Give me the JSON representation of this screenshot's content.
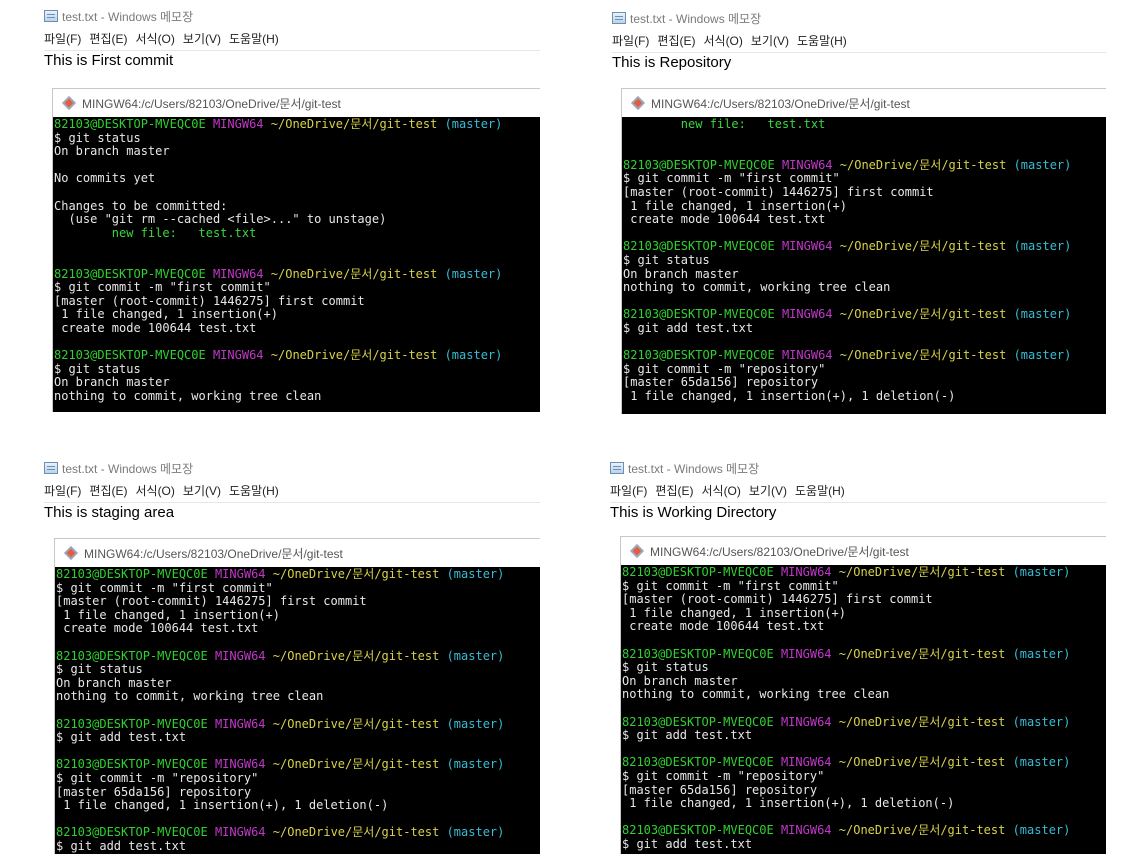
{
  "notepad": {
    "title": "test.txt - Windows 메모장",
    "menu": [
      "파일(F)",
      "편집(E)",
      "서식(O)",
      "보기(V)",
      "도움말(H)"
    ]
  },
  "terminal_title": "MINGW64:/c/Users/82103/OneDrive/문서/git-test",
  "prompt": {
    "user": "82103@DESKTOP-MVEQC0E",
    "env": "MINGW64",
    "path": "~/OneDrive/문서/git-test",
    "branch": "(master)"
  },
  "panels": [
    {
      "file_text": "This is First commit",
      "lines": [
        {
          "t": "prompt"
        },
        {
          "t": "text",
          "v": "$ git status"
        },
        {
          "t": "text",
          "v": "On branch master"
        },
        {
          "t": "blank"
        },
        {
          "t": "text",
          "v": "No commits yet"
        },
        {
          "t": "blank"
        },
        {
          "t": "text",
          "v": "Changes to be committed:"
        },
        {
          "t": "text",
          "v": "  (use \"git rm --cached <file>...\" to unstage)"
        },
        {
          "t": "green",
          "v": "        new file:   test.txt"
        },
        {
          "t": "blank"
        },
        {
          "t": "blank"
        },
        {
          "t": "prompt"
        },
        {
          "t": "text",
          "v": "$ git commit -m \"first commit\""
        },
        {
          "t": "text",
          "v": "[master (root-commit) 1446275] first commit"
        },
        {
          "t": "text",
          "v": " 1 file changed, 1 insertion(+)"
        },
        {
          "t": "text",
          "v": " create mode 100644 test.txt"
        },
        {
          "t": "blank"
        },
        {
          "t": "prompt"
        },
        {
          "t": "text",
          "v": "$ git status"
        },
        {
          "t": "text",
          "v": "On branch master"
        },
        {
          "t": "text",
          "v": "nothing to commit, working tree clean"
        }
      ]
    },
    {
      "file_text": "This is Repository",
      "lines": [
        {
          "t": "green",
          "v": "        new file:   test.txt"
        },
        {
          "t": "blank"
        },
        {
          "t": "blank"
        },
        {
          "t": "prompt"
        },
        {
          "t": "text",
          "v": "$ git commit -m \"first commit\""
        },
        {
          "t": "text",
          "v": "[master (root-commit) 1446275] first commit"
        },
        {
          "t": "text",
          "v": " 1 file changed, 1 insertion(+)"
        },
        {
          "t": "text",
          "v": " create mode 100644 test.txt"
        },
        {
          "t": "blank"
        },
        {
          "t": "prompt"
        },
        {
          "t": "text",
          "v": "$ git status"
        },
        {
          "t": "text",
          "v": "On branch master"
        },
        {
          "t": "text",
          "v": "nothing to commit, working tree clean"
        },
        {
          "t": "blank"
        },
        {
          "t": "prompt"
        },
        {
          "t": "text",
          "v": "$ git add test.txt"
        },
        {
          "t": "blank"
        },
        {
          "t": "prompt"
        },
        {
          "t": "text",
          "v": "$ git commit -m \"repository\""
        },
        {
          "t": "text",
          "v": "[master 65da156] repository"
        },
        {
          "t": "text",
          "v": " 1 file changed, 1 insertion(+), 1 deletion(-)"
        }
      ]
    },
    {
      "file_text": "This is staging area",
      "lines": [
        {
          "t": "prompt"
        },
        {
          "t": "text",
          "v": "$ git commit -m \"first commit\""
        },
        {
          "t": "text",
          "v": "[master (root-commit) 1446275] first commit"
        },
        {
          "t": "text",
          "v": " 1 file changed, 1 insertion(+)"
        },
        {
          "t": "text",
          "v": " create mode 100644 test.txt"
        },
        {
          "t": "blank"
        },
        {
          "t": "prompt"
        },
        {
          "t": "text",
          "v": "$ git status"
        },
        {
          "t": "text",
          "v": "On branch master"
        },
        {
          "t": "text",
          "v": "nothing to commit, working tree clean"
        },
        {
          "t": "blank"
        },
        {
          "t": "prompt"
        },
        {
          "t": "text",
          "v": "$ git add test.txt"
        },
        {
          "t": "blank"
        },
        {
          "t": "prompt"
        },
        {
          "t": "text",
          "v": "$ git commit -m \"repository\""
        },
        {
          "t": "text",
          "v": "[master 65da156] repository"
        },
        {
          "t": "text",
          "v": " 1 file changed, 1 insertion(+), 1 deletion(-)"
        },
        {
          "t": "blank"
        },
        {
          "t": "prompt"
        },
        {
          "t": "text",
          "v": "$ git add test.txt"
        }
      ]
    },
    {
      "file_text": "This is Working Directory",
      "lines": [
        {
          "t": "prompt"
        },
        {
          "t": "text",
          "v": "$ git commit -m \"first commit\""
        },
        {
          "t": "text",
          "v": "[master (root-commit) 1446275] first commit"
        },
        {
          "t": "text",
          "v": " 1 file changed, 1 insertion(+)"
        },
        {
          "t": "text",
          "v": " create mode 100644 test.txt"
        },
        {
          "t": "blank"
        },
        {
          "t": "prompt"
        },
        {
          "t": "text",
          "v": "$ git status"
        },
        {
          "t": "text",
          "v": "On branch master"
        },
        {
          "t": "text",
          "v": "nothing to commit, working tree clean"
        },
        {
          "t": "blank"
        },
        {
          "t": "prompt"
        },
        {
          "t": "text",
          "v": "$ git add test.txt"
        },
        {
          "t": "blank"
        },
        {
          "t": "prompt"
        },
        {
          "t": "text",
          "v": "$ git commit -m \"repository\""
        },
        {
          "t": "text",
          "v": "[master 65da156] repository"
        },
        {
          "t": "text",
          "v": " 1 file changed, 1 insertion(+), 1 deletion(-)"
        },
        {
          "t": "blank"
        },
        {
          "t": "prompt"
        },
        {
          "t": "text",
          "v": "$ git add test.txt"
        }
      ]
    }
  ]
}
